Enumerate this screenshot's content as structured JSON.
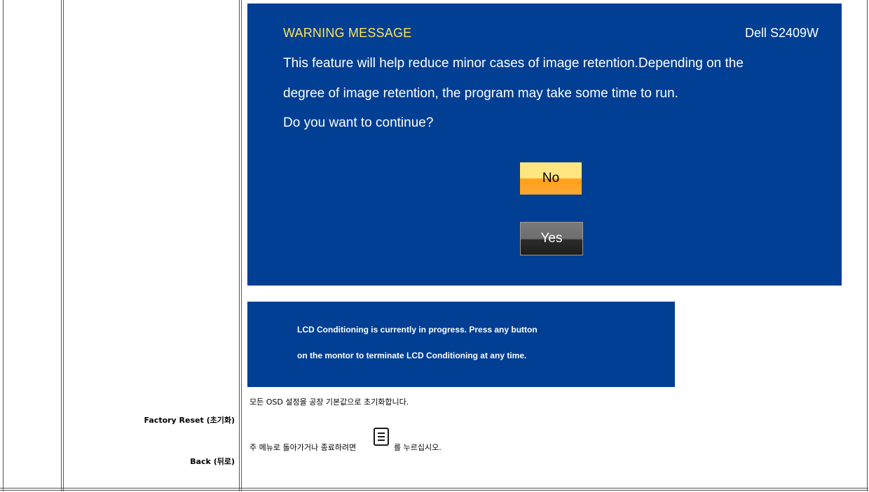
{
  "osd_warning": {
    "title": "WARNING MESSAGE",
    "model": "Dell S2409W",
    "line1": "This feature will help reduce minor cases of image retention.Depending on the",
    "line2": "degree of image retention, the program may take some time to run.",
    "line3": "Do you want to continue?",
    "no_label": "No",
    "yes_label": "Yes",
    "background_color": "#003f93",
    "title_color": "#ffe45c"
  },
  "lcd_banner": {
    "line1": "LCD Conditioning is currently in progress. Press any button",
    "line2": "on the montor to terminate LCD Conditioning at any time."
  },
  "rows": {
    "factory_reset": {
      "label": "Factory Reset (초기화)",
      "description": "모든 OSD 설정을 공장 기본값으로 초기화합니다."
    },
    "back": {
      "label": "Back (뒤로)",
      "description_before": "주 메뉴로 돌아가거나 종료하려면",
      "description_after": "를 누르십시오.",
      "icon": "menu-button-icon"
    }
  }
}
